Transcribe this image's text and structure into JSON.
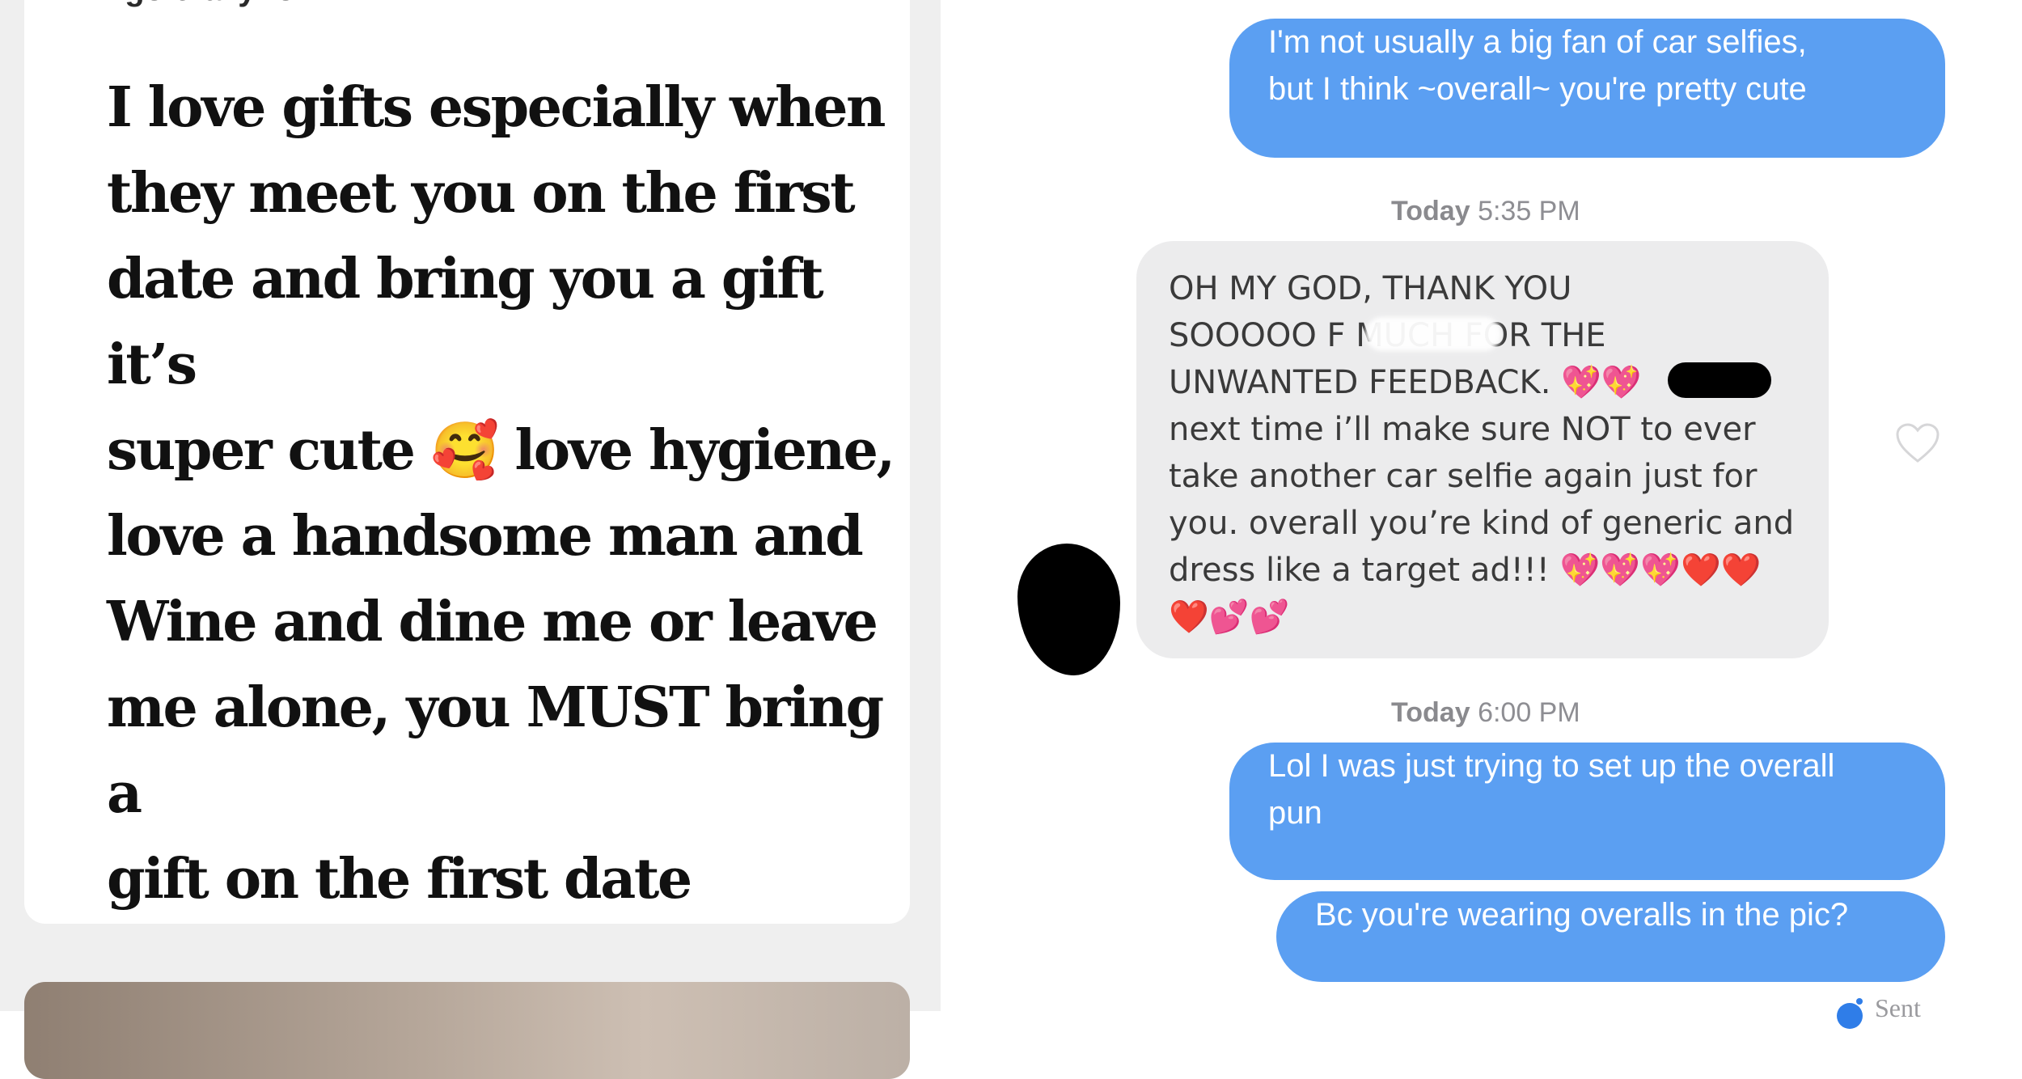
{
  "profile": {
    "prompt_question": "I go crazy for",
    "prompt_answer": "I love gifts especially when\nthey meet you on the first\ndate and bring you a gift it’s\nsuper cute 🥰 love hygiene,\nlove a handsome man and\nWine and dine me or leave\nme alone, you MUST bring a\ngift on the first date"
  },
  "chat": {
    "messages": [
      {
        "direction": "sent",
        "text": "I'm not usually a big fan of car selfies,\nbut I think ~overall~ you're pretty cute"
      },
      {
        "direction": "received",
        "text": "OH MY GOD, THANK YOU\nSOOOOO F         MUCH FOR THE\nUNWANTED FEEDBACK. 💖💖\nnext time i’ll make sure NOT to ever\ntake another car selfie again just for\nyou. overall you’re kind of generic and\ndress like a target ad!!! 💖💖💖❤️❤️\n❤️💕💕"
      },
      {
        "direction": "sent",
        "text": "Lol I was just trying to set up the overall\npun"
      },
      {
        "direction": "sent",
        "text": "Bc you're wearing overalls in the pic?"
      }
    ],
    "timestamps": [
      {
        "day": "Today",
        "time": "5:35 PM"
      },
      {
        "day": "Today",
        "time": "6:00 PM"
      }
    ],
    "send_status": "Sent",
    "colors": {
      "sent_bubble": "#5b9ff2",
      "received_bubble": "#ececed"
    }
  }
}
